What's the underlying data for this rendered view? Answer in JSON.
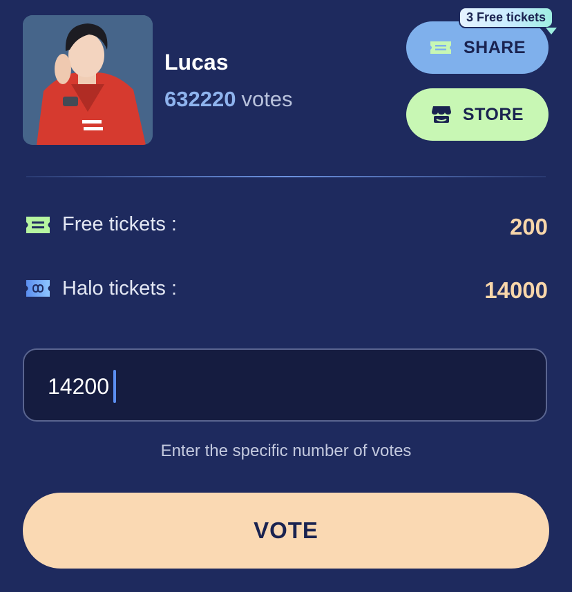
{
  "profile": {
    "name": "Lucas",
    "votes_count": "632220",
    "votes_word": "votes"
  },
  "actions": {
    "share_label": "SHARE",
    "share_badge": "3 Free tickets",
    "store_label": "STORE"
  },
  "tickets": [
    {
      "label": "Free tickets :",
      "value": "200",
      "icon": "ticket-icon"
    },
    {
      "label": "Halo tickets :",
      "value": "14000",
      "icon": "infinity-ticket-icon"
    }
  ],
  "vote_input": {
    "value": "14200",
    "hint": "Enter the specific number of votes"
  },
  "vote_button_label": "VOTE",
  "colors": {
    "background": "#1e2a5e",
    "share_button": "#7fb0ec",
    "store_button": "#c8f7b4",
    "ticket_value": "#f8d6aa",
    "vote_button": "#fad9b3",
    "votes_number": "#8fb4ee"
  }
}
